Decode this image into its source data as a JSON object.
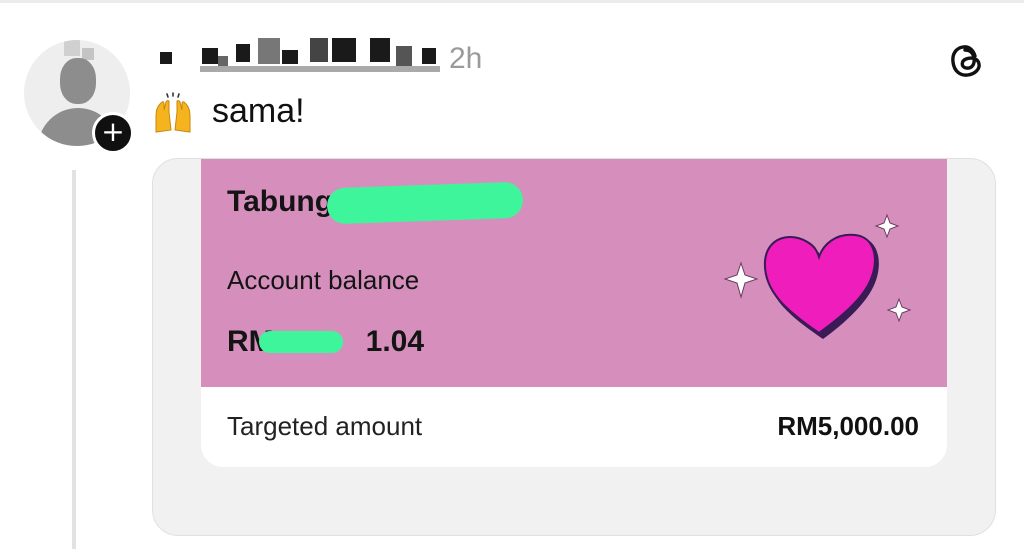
{
  "post": {
    "username": "",
    "timestamp": "2h",
    "text": "sama!",
    "emoji_icon": "raising-hands-icon",
    "follow_icon": "plus-icon",
    "follow_symbol": "+",
    "app_icon": "threads-logo-icon"
  },
  "savings_card": {
    "title": "Tabung",
    "balance_label": "Account balance",
    "balance_value": "RM",
    "balance_tail": "1.04",
    "target_label": "Targeted amount",
    "target_value": "RM5,000.00",
    "colors": {
      "card_top": "#d68fbd",
      "heart": "#f01dbd",
      "redaction": "#3ff59c"
    }
  }
}
